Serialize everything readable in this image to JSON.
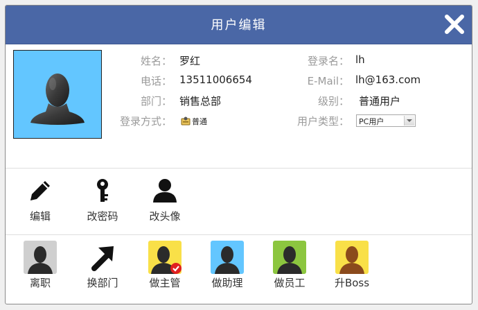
{
  "dialog": {
    "title": "用户编辑",
    "close_icon": "close-icon"
  },
  "profile": {
    "avatar_icon": "user-silhouette-icon",
    "name_label": "姓名：",
    "name_value": "罗红",
    "phone_label": "电话：",
    "phone_value": "13511006654",
    "dept_label": "部门：",
    "dept_value": "销售总部",
    "login_method_label": "登录方式：",
    "login_method_value": "普通",
    "login_name_label": "登录名：",
    "login_name_value": "lh",
    "email_label": "E-Mail：",
    "email_value": "lh@163.com",
    "level_label": "级别：",
    "level_value": "普通用户",
    "user_type_label": "用户类型：",
    "user_type_value": "PC用户"
  },
  "actions": [
    {
      "label": "编辑",
      "icon": "pencil-icon"
    },
    {
      "label": "改密码",
      "icon": "key-icon"
    },
    {
      "label": "改头像",
      "icon": "user-icon"
    }
  ],
  "roles": [
    {
      "label": "离职",
      "icon": "resign-user-icon",
      "bg": "#cfcfcf",
      "figure": "#2b2b2b"
    },
    {
      "label": "换部门",
      "icon": "arrow-up-right-icon",
      "bg": "transparent",
      "figure": "#111111"
    },
    {
      "label": "做主管",
      "icon": "supervisor-user-icon",
      "bg": "#f9e048",
      "figure": "#2b2b2b",
      "badge": "#e02020"
    },
    {
      "label": "做助理",
      "icon": "assistant-user-icon",
      "bg": "#63c6ff",
      "figure": "#2b2b2b"
    },
    {
      "label": "做员工",
      "icon": "employee-user-icon",
      "bg": "#8cc63f",
      "figure": "#2b2b2b"
    },
    {
      "label": "升Boss",
      "icon": "boss-user-icon",
      "bg": "#f9e048",
      "figure": "#8b4a1c"
    }
  ],
  "colors": {
    "titlebar": "#4a67a6",
    "avatar_bg": "#63c6ff"
  }
}
